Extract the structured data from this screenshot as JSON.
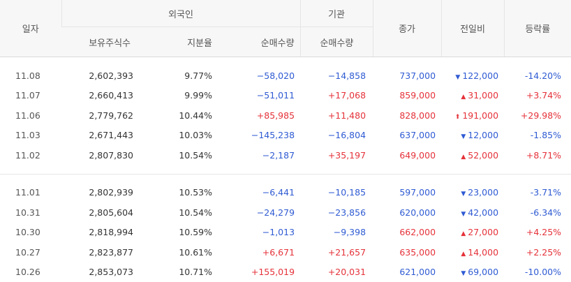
{
  "header": {
    "date": "일자",
    "foreign": "외국인",
    "institution": "기관",
    "close": "종가",
    "change": "전일비",
    "rate": "등락률",
    "holdings": "보유주식수",
    "ratio": "지분율",
    "net_foreign": "순매수량",
    "net_inst": "순매수량"
  },
  "group1": [
    {
      "date": "11.08",
      "holdings": "2,602,393",
      "ratio": "9.77%",
      "foreign": "−58,020",
      "foreign_dir": "neg",
      "inst": "−14,858",
      "inst_dir": "neg",
      "close": "737,000",
      "close_dir": "neg",
      "change": "122,000",
      "change_icon": "▼",
      "change_dir": "neg",
      "rate": "-14.20%",
      "rate_dir": "neg"
    },
    {
      "date": "11.07",
      "holdings": "2,660,413",
      "ratio": "9.99%",
      "foreign": "−51,011",
      "foreign_dir": "neg",
      "inst": "+17,068",
      "inst_dir": "pos",
      "close": "859,000",
      "close_dir": "pos",
      "change": "31,000",
      "change_icon": "▲",
      "change_dir": "pos",
      "rate": "+3.74%",
      "rate_dir": "pos"
    },
    {
      "date": "11.06",
      "holdings": "2,779,762",
      "ratio": "10.44%",
      "foreign": "+85,985",
      "foreign_dir": "pos",
      "inst": "+11,480",
      "inst_dir": "pos",
      "close": "828,000",
      "close_dir": "pos",
      "change": "191,000",
      "change_icon": "⬆",
      "change_dir": "pos",
      "rate": "+29.98%",
      "rate_dir": "pos"
    },
    {
      "date": "11.03",
      "holdings": "2,671,443",
      "ratio": "10.03%",
      "foreign": "−145,238",
      "foreign_dir": "neg",
      "inst": "−16,804",
      "inst_dir": "neg",
      "close": "637,000",
      "close_dir": "neg",
      "change": "12,000",
      "change_icon": "▼",
      "change_dir": "neg",
      "rate": "-1.85%",
      "rate_dir": "neg"
    },
    {
      "date": "11.02",
      "holdings": "2,807,830",
      "ratio": "10.54%",
      "foreign": "−2,187",
      "foreign_dir": "neg",
      "inst": "+35,197",
      "inst_dir": "pos",
      "close": "649,000",
      "close_dir": "pos",
      "change": "52,000",
      "change_icon": "▲",
      "change_dir": "pos",
      "rate": "+8.71%",
      "rate_dir": "pos"
    }
  ],
  "group2": [
    {
      "date": "11.01",
      "holdings": "2,802,939",
      "ratio": "10.53%",
      "foreign": "−6,441",
      "foreign_dir": "neg",
      "inst": "−10,185",
      "inst_dir": "neg",
      "close": "597,000",
      "close_dir": "neg",
      "change": "23,000",
      "change_icon": "▼",
      "change_dir": "neg",
      "rate": "-3.71%",
      "rate_dir": "neg"
    },
    {
      "date": "10.31",
      "holdings": "2,805,604",
      "ratio": "10.54%",
      "foreign": "−24,279",
      "foreign_dir": "neg",
      "inst": "−23,856",
      "inst_dir": "neg",
      "close": "620,000",
      "close_dir": "neg",
      "change": "42,000",
      "change_icon": "▼",
      "change_dir": "neg",
      "rate": "-6.34%",
      "rate_dir": "neg"
    },
    {
      "date": "10.30",
      "holdings": "2,818,994",
      "ratio": "10.59%",
      "foreign": "−1,013",
      "foreign_dir": "neg",
      "inst": "−9,398",
      "inst_dir": "neg",
      "close": "662,000",
      "close_dir": "pos",
      "change": "27,000",
      "change_icon": "▲",
      "change_dir": "pos",
      "rate": "+4.25%",
      "rate_dir": "pos"
    },
    {
      "date": "10.27",
      "holdings": "2,823,877",
      "ratio": "10.61%",
      "foreign": "+6,671",
      "foreign_dir": "pos",
      "inst": "+21,657",
      "inst_dir": "pos",
      "close": "635,000",
      "close_dir": "pos",
      "change": "14,000",
      "change_icon": "▲",
      "change_dir": "pos",
      "rate": "+2.25%",
      "rate_dir": "pos"
    },
    {
      "date": "10.26",
      "holdings": "2,853,073",
      "ratio": "10.71%",
      "foreign": "+155,019",
      "foreign_dir": "pos",
      "inst": "+20,031",
      "inst_dir": "pos",
      "close": "621,000",
      "close_dir": "neg",
      "change": "69,000",
      "change_icon": "▼",
      "change_dir": "neg",
      "rate": "-10.00%",
      "rate_dir": "neg"
    }
  ]
}
